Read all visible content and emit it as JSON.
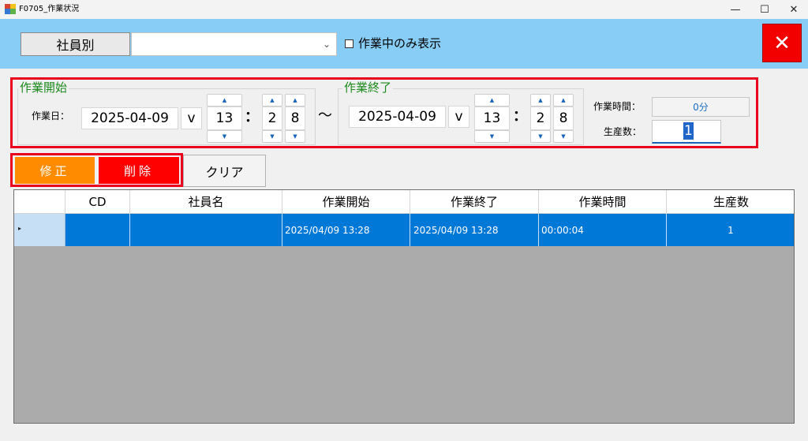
{
  "window": {
    "title": "F0705_作業状況",
    "controls": {
      "minimize": "—",
      "maximize": "☐",
      "close": "✕"
    }
  },
  "header": {
    "employee_button": "社員別",
    "employee_select_value": "",
    "active_only_label": "作業中のみ表示",
    "active_only_checked": false,
    "close_symbol": "✕"
  },
  "start": {
    "group_title": "作業開始",
    "date_label": "作業日：",
    "date": "2025-04-09",
    "dropdown": "v",
    "hour": "13",
    "minute_tens": "2",
    "minute_ones": "8",
    "spin_up": "▲",
    "spin_down": "▼",
    "colon": "："
  },
  "separator": "～",
  "end": {
    "group_title": "作業終了",
    "date": "2025-04-09",
    "dropdown": "v",
    "hour": "13",
    "minute_tens": "2",
    "minute_ones": "8",
    "spin_up": "▲",
    "spin_down": "▼",
    "colon": "："
  },
  "summary": {
    "work_time_label": "作業時間：",
    "work_time_value": "0分",
    "production_label": "生産数：",
    "production_value": "1"
  },
  "actions": {
    "edit": "修正",
    "delete": "削除",
    "clear": "クリア"
  },
  "grid": {
    "columns": [
      "CD",
      "社員名",
      "作業開始",
      "作業終了",
      "作業時間",
      "生産数"
    ],
    "rows": [
      {
        "cd": "",
        "name": "",
        "start": "2025/04/09 13:28",
        "end": "2025/04/09 13:28",
        "duration": "00:00:04",
        "count": "1"
      }
    ],
    "row_indicator": "▸"
  },
  "colors": {
    "header_bg": "#87cdf5",
    "edit": "#ff8c00",
    "delete": "#ff0000",
    "selected_row": "#0078d7",
    "group_title": "#1c8a1c"
  }
}
